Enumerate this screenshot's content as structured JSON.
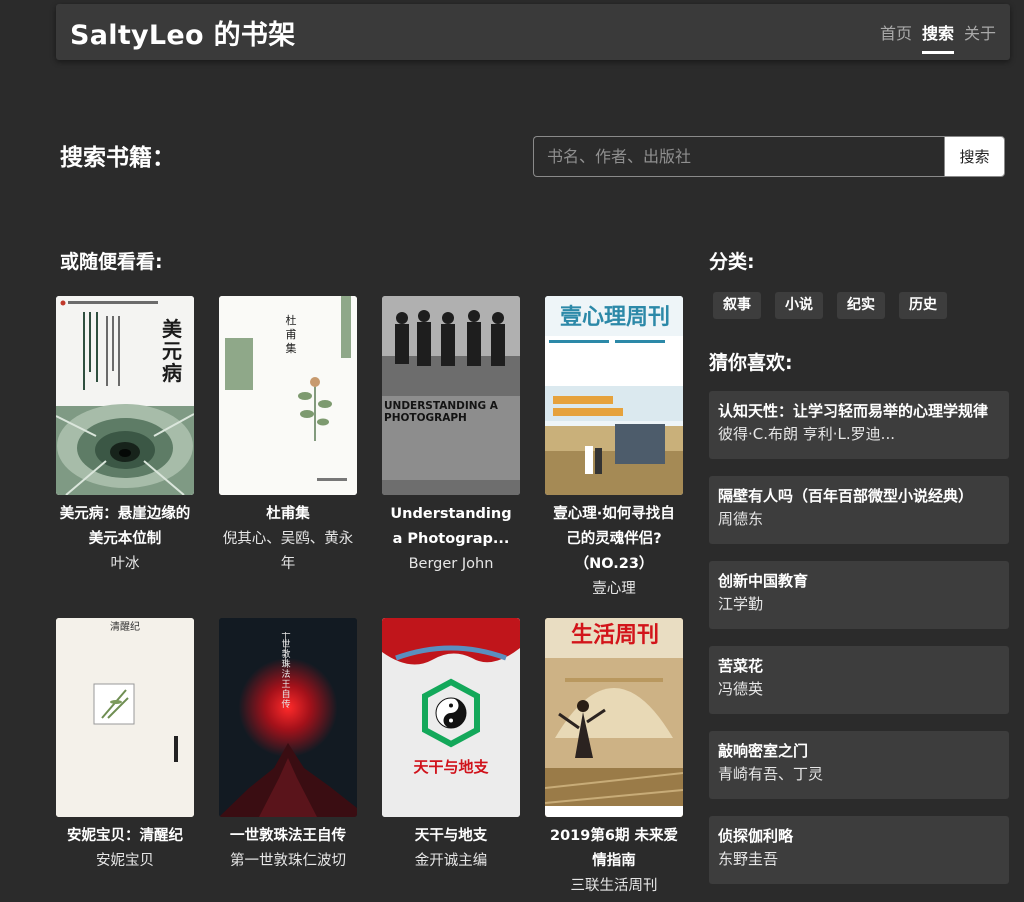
{
  "header": {
    "brand": "SaltyLeo 的书架",
    "nav": [
      "首页",
      "搜索",
      "关于"
    ],
    "active_nav": "搜索"
  },
  "search": {
    "heading": "搜索书籍：",
    "placeholder": "书名、作者、出版社",
    "button_label": "搜索"
  },
  "browse": {
    "heading": "或随便看看:",
    "books": [
      {
        "title": "美元病：悬崖边缘的美元本位制",
        "author": "叶冰",
        "cover_text": "美元病"
      },
      {
        "title": "杜甫集",
        "author": "倪其心、吴鸥、黄永年",
        "cover_text": "杜甫集"
      },
      {
        "title": "Understanding a Photograp...",
        "author": "Berger John",
        "cover_text": "UNDERSTANDING A PHOTOGRAPH"
      },
      {
        "title": "壹心理·如何寻找自己的灵魂伴侣?（NO.23）",
        "author": "壹心理",
        "cover_text": "壹心理周刊"
      },
      {
        "title": "安妮宝贝：清醒纪",
        "author": "安妮宝贝",
        "cover_text": "清醒纪"
      },
      {
        "title": "一世敦珠法王自传",
        "author": "第一世敦珠仁波切",
        "cover_text": "一世敦珠法王自传"
      },
      {
        "title": "天干与地支",
        "author": "金开诚主编",
        "cover_text": "天干与地支"
      },
      {
        "title": "2019第6期 未来爱情指南",
        "author": "三联生活周刊",
        "cover_text": "生活周刊"
      }
    ]
  },
  "categories": {
    "heading": "分类:",
    "items": [
      "叙事",
      "小说",
      "纪实",
      "历史"
    ]
  },
  "recommend": {
    "heading": "猜你喜欢:",
    "items": [
      {
        "title": "认知天性：让学习轻而易举的心理学规律",
        "author": "彼得·C.布朗 亨利·L.罗迪..."
      },
      {
        "title": "隔壁有人吗（百年百部微型小说经典）",
        "author": "周德东"
      },
      {
        "title": "创新中国教育",
        "author": "江学勤"
      },
      {
        "title": "苦菜花",
        "author": "冯德英"
      },
      {
        "title": "敲响密室之门",
        "author": "青崎有吾、丁灵"
      },
      {
        "title": "侦探伽利略",
        "author": "东野圭吾"
      }
    ]
  }
}
